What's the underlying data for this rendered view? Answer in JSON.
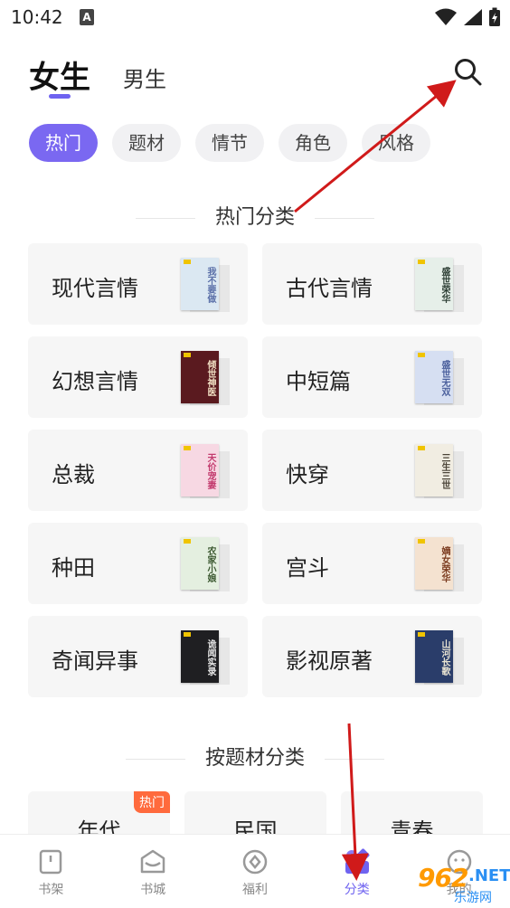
{
  "status": {
    "time": "10:42",
    "a_icon": "A"
  },
  "header": {
    "tab_female": "女生",
    "tab_male": "男生",
    "search_icon": "search-icon"
  },
  "chips": [
    "热门",
    "题材",
    "情节",
    "角色",
    "风格"
  ],
  "section_hot": "热门分类",
  "categories": [
    {
      "label": "现代言情",
      "cover_title": "我不要做",
      "cover_bg": "#dbe8f2",
      "cover_fg": "#5a6fa8"
    },
    {
      "label": "古代言情",
      "cover_title": "盛世荣华",
      "cover_bg": "#e6efe9",
      "cover_fg": "#2d3f35"
    },
    {
      "label": "幻想言情",
      "cover_title": "倾世神医",
      "cover_bg": "#5a1a1f",
      "cover_fg": "#f3e3c6"
    },
    {
      "label": "中短篇",
      "cover_title": "盛世无双",
      "cover_bg": "#d6dff2",
      "cover_fg": "#4a5f9c"
    },
    {
      "label": "总裁",
      "cover_title": "天价宠妻",
      "cover_bg": "#f7d8e3",
      "cover_fg": "#c23a6d"
    },
    {
      "label": "快穿",
      "cover_title": "三生三世",
      "cover_bg": "#f1ede2",
      "cover_fg": "#4b4438"
    },
    {
      "label": "种田",
      "cover_title": "农家小娘",
      "cover_bg": "#e4efe0",
      "cover_fg": "#3d5a32"
    },
    {
      "label": "宫斗",
      "cover_title": "嫡女荣华",
      "cover_bg": "#f4e2d0",
      "cover_fg": "#7a3a1e"
    },
    {
      "label": "奇闻异事",
      "cover_title": "诡闻实录",
      "cover_bg": "#1f1f22",
      "cover_fg": "#e6e6e6"
    },
    {
      "label": "影视原著",
      "cover_title": "山河长歌",
      "cover_bg": "#2a3d6a",
      "cover_fg": "#e8e3d2"
    }
  ],
  "section_topic": "按题材分类",
  "topics": [
    {
      "label": "年代",
      "badge": "热门"
    },
    {
      "label": "民国",
      "badge": ""
    },
    {
      "label": "青春",
      "badge": ""
    }
  ],
  "nav": [
    {
      "label": "书架",
      "icon": "bookshelf-icon"
    },
    {
      "label": "书城",
      "icon": "bookstore-icon"
    },
    {
      "label": "福利",
      "icon": "welfare-icon"
    },
    {
      "label": "分类",
      "icon": "category-icon"
    },
    {
      "label": "我的",
      "icon": "profile-icon"
    }
  ],
  "watermark": {
    "num": "962",
    "net": ".NET",
    "sub": "乐游网"
  },
  "colors": {
    "accent": "#7a68f1",
    "arrow": "#d01a1a"
  }
}
